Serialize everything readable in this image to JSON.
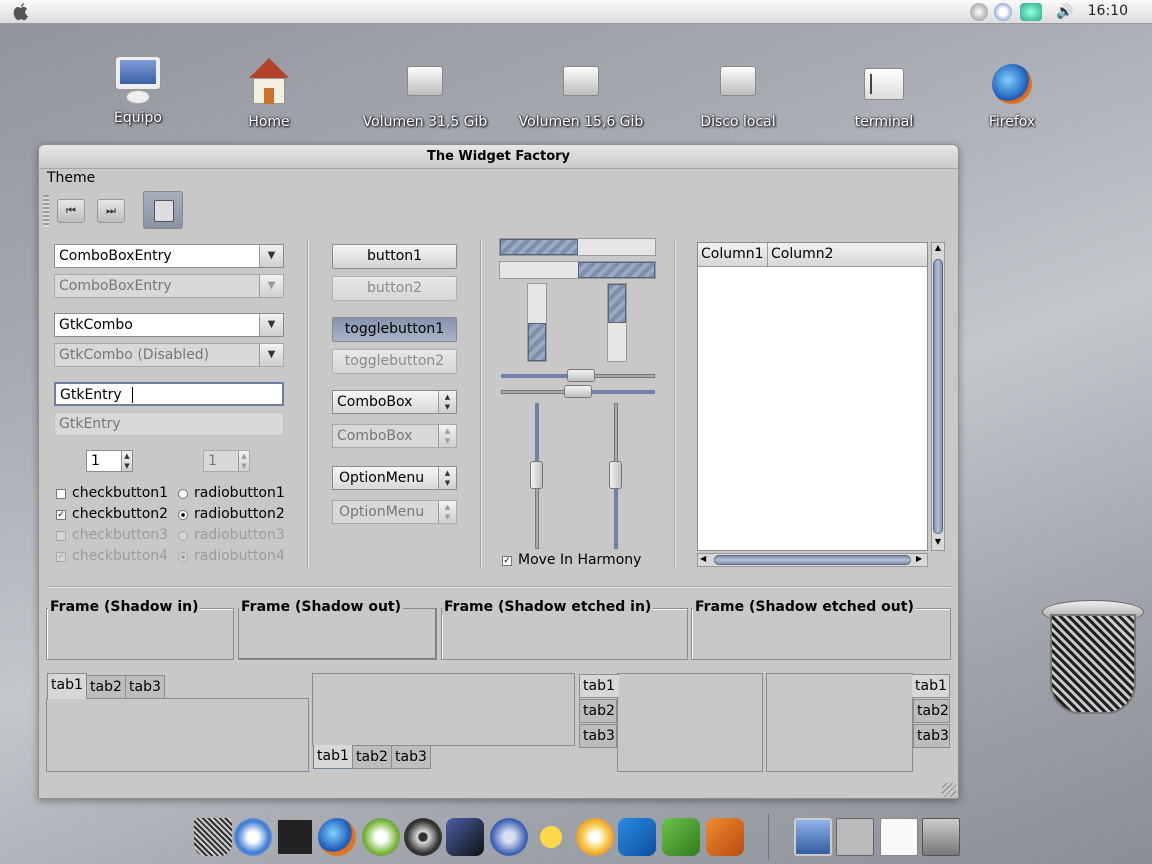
{
  "topbar": {
    "clock": "16:10"
  },
  "desktop_icons": [
    {
      "label": "Equipo",
      "icon": "computer-icon"
    },
    {
      "label": "Home",
      "icon": "home-icon"
    },
    {
      "label": "Volumen 31,5 Gib",
      "icon": "drive-icon"
    },
    {
      "label": "Volumen 15,6 Gib",
      "icon": "drive-icon"
    },
    {
      "label": "Disco local",
      "icon": "drive-icon"
    },
    {
      "label": "terminal",
      "icon": "terminal-icon"
    },
    {
      "label": "Firefox",
      "icon": "firefox-icon"
    }
  ],
  "window": {
    "title": "The Widget Factory",
    "menu": "Theme"
  },
  "left": {
    "combo1": "ComboBoxEntry",
    "combo2": "ComboBoxEntry",
    "gtkcombo1": "GtkCombo",
    "gtkcombo2": "GtkCombo (Disabled)",
    "entry1": "GtkEntry",
    "entry2": "GtkEntry",
    "spin1": "1",
    "spin2": "1",
    "check": [
      "checkbutton1",
      "checkbutton2",
      "checkbutton3",
      "checkbutton4"
    ],
    "radio": [
      "radiobutton1",
      "radiobutton2",
      "radiobutton3",
      "radiobutton4"
    ]
  },
  "middle": {
    "button1": "button1",
    "button2": "button2",
    "toggle1": "togglebutton1",
    "toggle2": "togglebutton2",
    "combobox1": "ComboBox",
    "combobox2": "ComboBox",
    "option1": "OptionMenu",
    "option2": "OptionMenu"
  },
  "progress": {
    "h1": 0.5,
    "h2": 0.5,
    "v1": 0.5,
    "v2": 0.5,
    "slider_h1": 0.5,
    "slider_h2": 0.5,
    "slider_v1": 0.5,
    "slider_v2": 0.5
  },
  "harmony": "Move In Harmony",
  "tree": {
    "columns": [
      "Column1",
      "Column2"
    ]
  },
  "frames": [
    "Frame (Shadow in)",
    "Frame (Shadow out)",
    "Frame (Shadow etched in)",
    "Frame (Shadow etched out)"
  ],
  "tabs": [
    "tab1",
    "tab2",
    "tab3"
  ]
}
